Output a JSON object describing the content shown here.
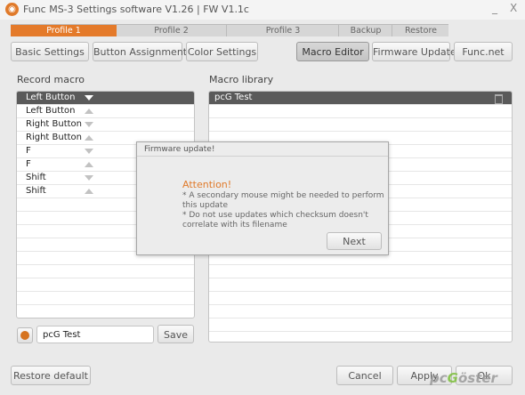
{
  "window": {
    "title": "Func MS-3 Settings software V1.26 | FW V1.1c",
    "minimize": "_",
    "close": "X"
  },
  "profiles": {
    "tabs": [
      {
        "label": "Profile 1",
        "active": true
      },
      {
        "label": "Profile 2",
        "active": false
      },
      {
        "label": "Profile 3",
        "active": false
      }
    ],
    "backup_label": "Backup",
    "restore_label": "Restore",
    "accent_color": "#e47a2a"
  },
  "nav": {
    "basic_settings": "Basic Settings",
    "button_assignment": "Button Assignment",
    "color_settings": "Color Settings",
    "macro_editor": "Macro Editor",
    "firmware_update": "Firmware Update",
    "func_net": "Func.net",
    "active": "Macro Editor"
  },
  "record_macro": {
    "label": "Record macro",
    "rows": [
      {
        "label": "Left Button",
        "direction": "down",
        "selected": true
      },
      {
        "label": "Left Button",
        "direction": "up",
        "selected": false
      },
      {
        "label": "Right Button",
        "direction": "down",
        "selected": false
      },
      {
        "label": "Right Button",
        "direction": "up",
        "selected": false
      },
      {
        "label": "F",
        "direction": "down",
        "selected": false
      },
      {
        "label": "F",
        "direction": "up",
        "selected": false
      },
      {
        "label": "Shift",
        "direction": "down",
        "selected": false
      },
      {
        "label": "Shift",
        "direction": "up",
        "selected": false
      }
    ],
    "name_value": "pcG Test",
    "save_label": "Save"
  },
  "macro_library": {
    "label": "Macro library",
    "items": [
      {
        "label": "pcG Test",
        "selected": true
      }
    ]
  },
  "dialog": {
    "title": "Firmware update!",
    "heading": "Attention!",
    "lines": [
      "* A secondary mouse might be needed to perform",
      "this update",
      "* Do not use updates which checksum doesn't",
      "correlate with its filename"
    ],
    "next_label": "Next"
  },
  "footer": {
    "restore_default": "Restore default",
    "cancel": "Cancel",
    "apply": "Apply",
    "ok": "Ok"
  },
  "watermark": {
    "part1": "pc",
    "part2": "G",
    "part3": "öster"
  }
}
